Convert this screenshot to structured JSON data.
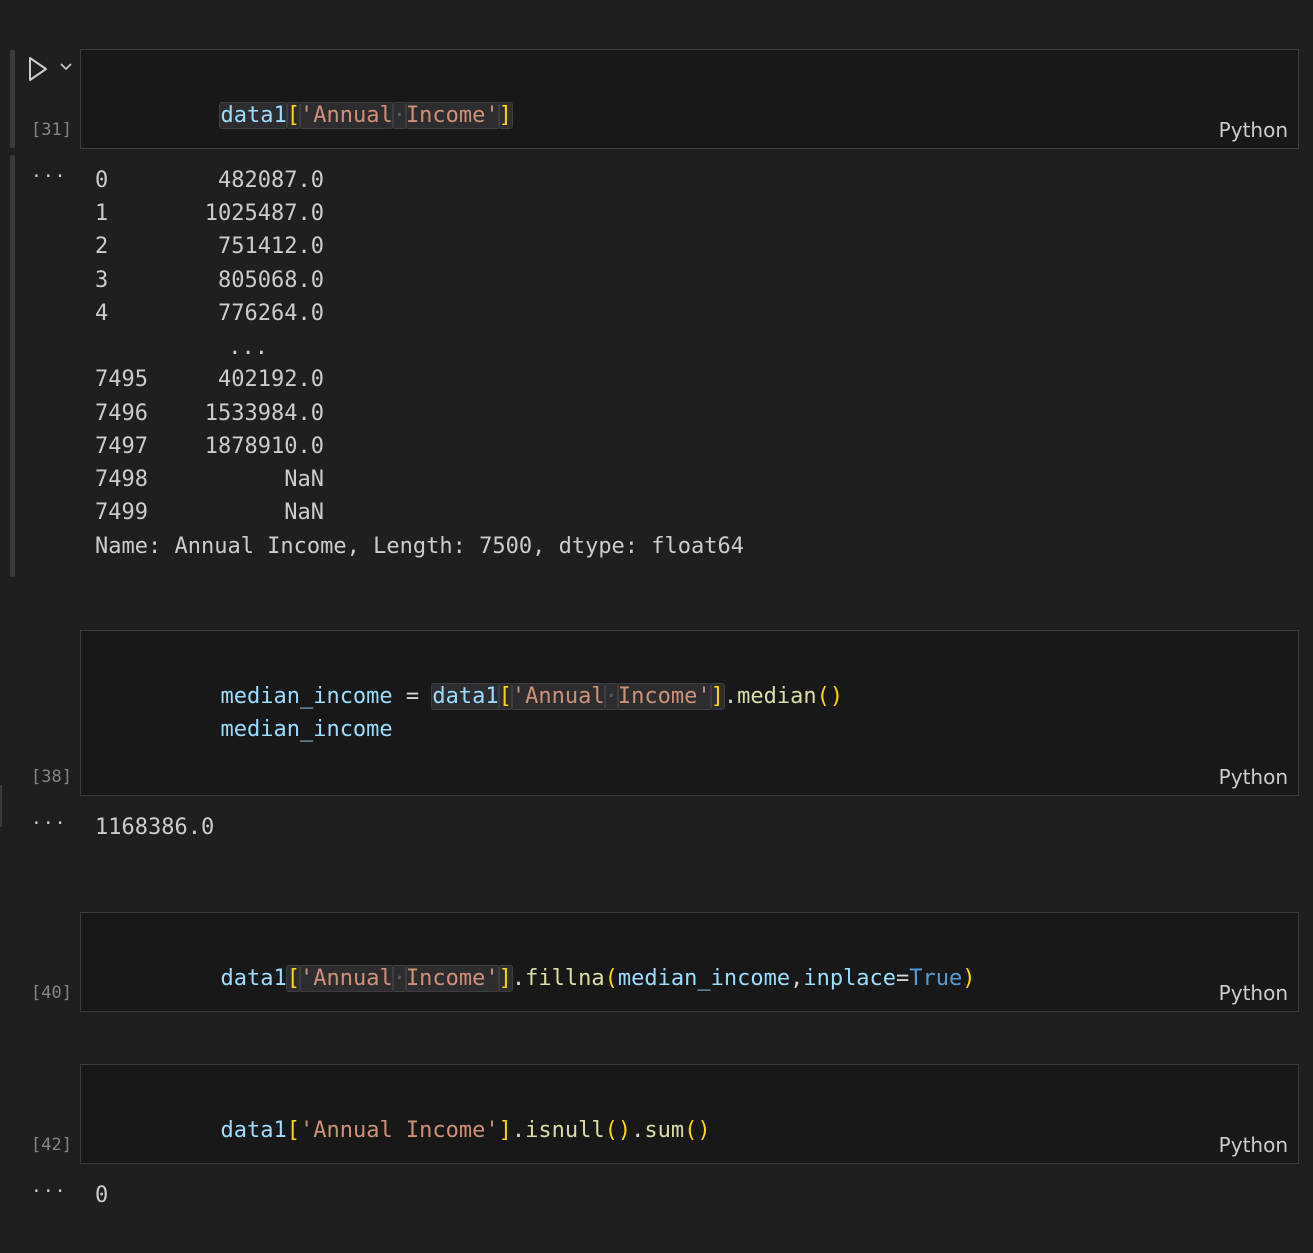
{
  "cells": [
    {
      "exec_count": "[31]",
      "language": "Python",
      "code": {
        "var": "data1",
        "open": "[",
        "str_a": "'Annual",
        "ws": "·",
        "str_b": "Income'",
        "close": "]"
      },
      "output": {
        "rows": [
          {
            "index": "0",
            "value": "482087.0"
          },
          {
            "index": "1",
            "value": "1025487.0"
          },
          {
            "index": "2",
            "value": "751412.0"
          },
          {
            "index": "3",
            "value": "805068.0"
          },
          {
            "index": "4",
            "value": "776264.0"
          },
          {
            "index": "",
            "value": "..."
          },
          {
            "index": "7495",
            "value": "402192.0"
          },
          {
            "index": "7496",
            "value": "1533984.0"
          },
          {
            "index": "7497",
            "value": "1878910.0"
          },
          {
            "index": "7498",
            "value": "NaN"
          },
          {
            "index": "7499",
            "value": "NaN"
          }
        ],
        "footer": "Name: Annual Income, Length: 7500, dtype: float64"
      }
    },
    {
      "exec_count": "[38]",
      "language": "Python",
      "code": {
        "line1_var": "median_income",
        "line1_eq": " = ",
        "line1_obj": "data1",
        "line1_open": "[",
        "line1_str_a": "'Annual",
        "line1_ws": "·",
        "line1_str_b": "Income'",
        "line1_close": "]",
        "line1_dot": ".",
        "line1_fn": "median",
        "line1_parens": "()",
        "line2_var": "median_income"
      },
      "output": {
        "value": "1168386.0"
      }
    },
    {
      "exec_count": "[40]",
      "language": "Python",
      "code": {
        "var": "data1",
        "open": "[",
        "str_a": "'Annual",
        "ws": "·",
        "str_b": "Income'",
        "close": "]",
        "dot": ".",
        "fn": "fillna",
        "popen": "(",
        "arg1": "median_income",
        "comma": ",",
        "kwarg": "inplace",
        "eq": "=",
        "kwval": "True",
        "pclose": ")"
      }
    },
    {
      "exec_count": "[42]",
      "language": "Python",
      "code": {
        "var": "data1",
        "open": "[",
        "str": "'Annual Income'",
        "close": "]",
        "dot1": ".",
        "fn1": "isnull",
        "p1": "()",
        "dot2": ".",
        "fn2": "sum",
        "p2": "()"
      },
      "output": {
        "value": "0"
      }
    }
  ],
  "output_marker": "···",
  "icons": {
    "run": "play-icon",
    "run_menu": "chevron-down-icon"
  },
  "colors": {
    "background": "#1f1f1f",
    "cell_background": "#181818",
    "cell_border": "#3c3c3c",
    "variable": "#9cdcfe",
    "string": "#ce9178",
    "bracket": "#ffd700",
    "function": "#dcdcaa",
    "keyword": "#569cd6"
  }
}
